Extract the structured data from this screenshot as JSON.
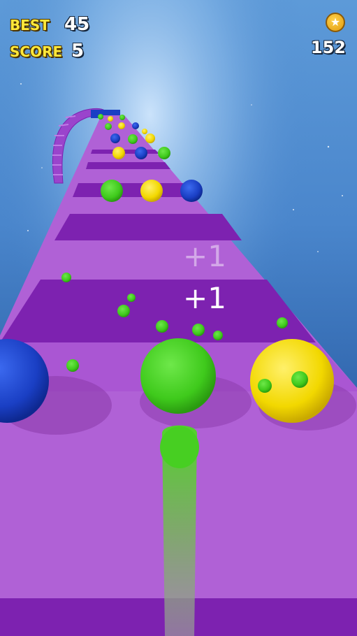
{
  "hud": {
    "best_label": "BEST",
    "best_value": "45",
    "score_label": "SCORE",
    "score_value": "5",
    "coins_value": "152",
    "coin_icon": "coin-star-icon"
  },
  "popups": [
    "+1",
    "+1"
  ],
  "colors": {
    "track_light": "#b061d6",
    "track_dark": "#7d22b0",
    "ball_green": "#3fca1c",
    "ball_yellow": "#f2d800",
    "ball_blue": "#1a3fc4",
    "sky_top": "#6aa6e0",
    "sky_bottom": "#1a4a8a"
  }
}
